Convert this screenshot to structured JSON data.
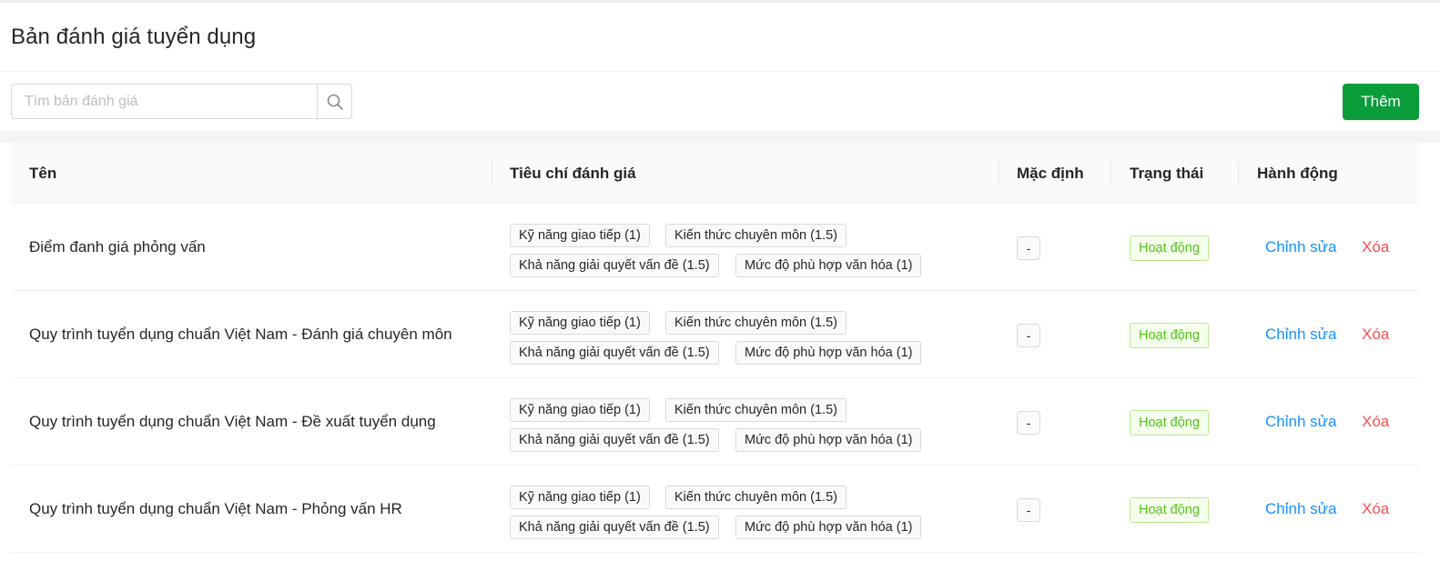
{
  "page": {
    "title": "Bản đánh giá tuyển dụng"
  },
  "search": {
    "placeholder": "Tìm bản đánh giá",
    "value": ""
  },
  "toolbar": {
    "add_label": "Thêm"
  },
  "colors": {
    "primary": "#0a9d3a",
    "link": "#1890ff",
    "danger": "#ff4d4f",
    "success": "#52c41a"
  },
  "icons": {
    "search": "search-icon"
  },
  "table": {
    "columns": [
      "Tên",
      "Tiêu chí đánh giá",
      "Mặc định",
      "Trạng thái",
      "Hành động"
    ],
    "rows": [
      {
        "name": "Điểm đanh giá phỏng vấn",
        "criteria": [
          "Kỹ năng giao tiếp (1)",
          "Kiến thức chuyên môn (1.5)",
          "Khả năng giải quyết vấn đề (1.5)",
          "Mức độ phù hợp văn hóa (1)"
        ],
        "default": "-",
        "status": "Hoạt động",
        "edit": "Chỉnh sửa",
        "delete": "Xóa"
      },
      {
        "name": "Quy trình tuyển dụng chuẩn Việt Nam - Đánh giá chuyên môn",
        "criteria": [
          "Kỹ năng giao tiếp (1)",
          "Kiến thức chuyên môn (1.5)",
          "Khả năng giải quyết vấn đề (1.5)",
          "Mức độ phù hợp văn hóa (1)"
        ],
        "default": "-",
        "status": "Hoạt động",
        "edit": "Chỉnh sửa",
        "delete": "Xóa"
      },
      {
        "name": "Quy trình tuyển dụng chuẩn Việt Nam - Đề xuất tuyển dụng",
        "criteria": [
          "Kỹ năng giao tiếp (1)",
          "Kiến thức chuyên môn (1.5)",
          "Khả năng giải quyết vấn đề (1.5)",
          "Mức độ phù hợp văn hóa (1)"
        ],
        "default": "-",
        "status": "Hoạt động",
        "edit": "Chỉnh sửa",
        "delete": "Xóa"
      },
      {
        "name": "Quy trình tuyển dụng chuẩn Việt Nam - Phỏng vấn HR",
        "criteria": [
          "Kỹ năng giao tiếp (1)",
          "Kiến thức chuyên môn (1.5)",
          "Khả năng giải quyết vấn đề (1.5)",
          "Mức độ phù hợp văn hóa (1)"
        ],
        "default": "-",
        "status": "Hoạt động",
        "edit": "Chỉnh sửa",
        "delete": "Xóa"
      }
    ]
  }
}
